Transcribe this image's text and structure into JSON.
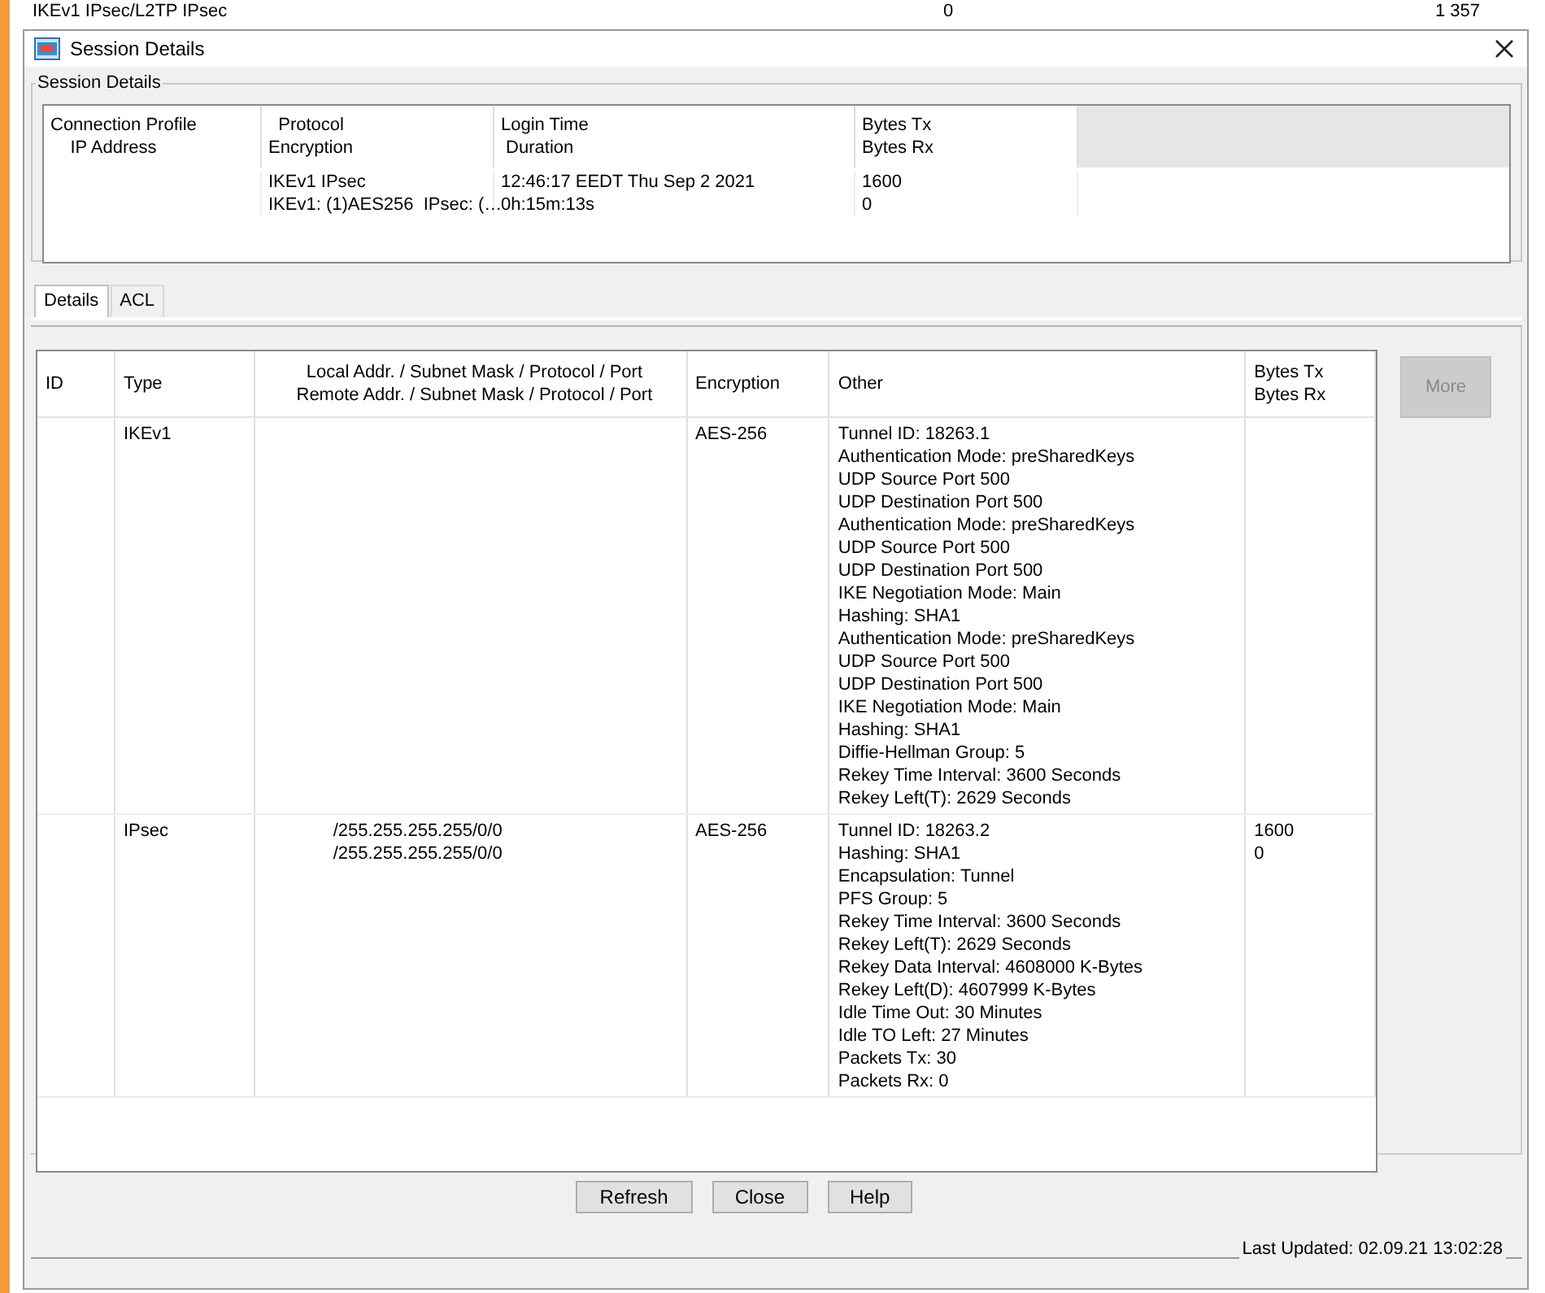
{
  "background_table": {
    "row": [
      "IKEv1 IPsec/L2TP IPsec",
      "0",
      "1 357"
    ]
  },
  "window": {
    "title": "Session Details"
  },
  "session_group": {
    "title": "Session Details",
    "columns": [
      "Connection Profile\n    IP Address",
      "  Protocol\nEncryption",
      "Login Time\n Duration",
      "Bytes Tx\nBytes Rx"
    ],
    "rows": [
      {
        "cells": [
          "",
          "IKEv1 IPsec\nIKEv1: (1)AES256  IPsec: (…",
          "12:46:17 EEDT Thu Sep 2 2021\n0h:15m:13s",
          "1600\n0"
        ]
      }
    ]
  },
  "tabs": [
    {
      "label": "Details",
      "selected": true
    },
    {
      "label": "ACL",
      "selected": false
    }
  ],
  "details_table": {
    "columns": [
      "ID",
      "Type",
      "Local Addr. / Subnet Mask / Protocol / Port\nRemote Addr. / Subnet Mask / Protocol / Port",
      "Encryption",
      "Other",
      "Bytes Tx\nBytes Rx"
    ],
    "rows": [
      {
        "id": "",
        "type": "IKEv1",
        "addresses": [],
        "encryption": "AES-256",
        "other": [
          "Tunnel ID: 18263.1",
          "Authentication Mode: preSharedKeys",
          "UDP Source Port 500",
          "UDP Destination Port 500",
          "Authentication Mode: preSharedKeys",
          "UDP Source Port 500",
          "UDP Destination Port 500",
          "IKE Negotiation Mode: Main",
          "Hashing: SHA1",
          "Authentication Mode: preSharedKeys",
          "UDP Source Port 500",
          "UDP Destination Port 500",
          "IKE Negotiation Mode: Main",
          "Hashing: SHA1",
          "Diffie-Hellman Group: 5",
          "Rekey Time Interval: 3600 Seconds",
          "Rekey Left(T): 2629 Seconds"
        ],
        "bytes": []
      },
      {
        "id": "",
        "type": "IPsec",
        "addresses": [
          "/255.255.255.255/0/0",
          "/255.255.255.255/0/0"
        ],
        "encryption": "AES-256",
        "other": [
          "Tunnel ID: 18263.2",
          "Hashing: SHA1",
          "Encapsulation: Tunnel",
          "PFS Group: 5",
          "Rekey Time Interval: 3600 Seconds",
          "Rekey Left(T): 2629 Seconds",
          "Rekey Data Interval: 4608000 K-Bytes",
          "Rekey Left(D): 4607999 K-Bytes",
          "Idle Time Out: 30 Minutes",
          "Idle TO Left: 27 Minutes",
          "Packets Tx: 30",
          "Packets Rx: 0"
        ],
        "bytes": [
          "1600",
          "0"
        ]
      }
    ]
  },
  "more_button": {
    "label": "More",
    "disabled": true
  },
  "buttons": [
    "Refresh",
    "Close",
    "Help"
  ],
  "status": "Last Updated: 02.09.21 13:02:28"
}
